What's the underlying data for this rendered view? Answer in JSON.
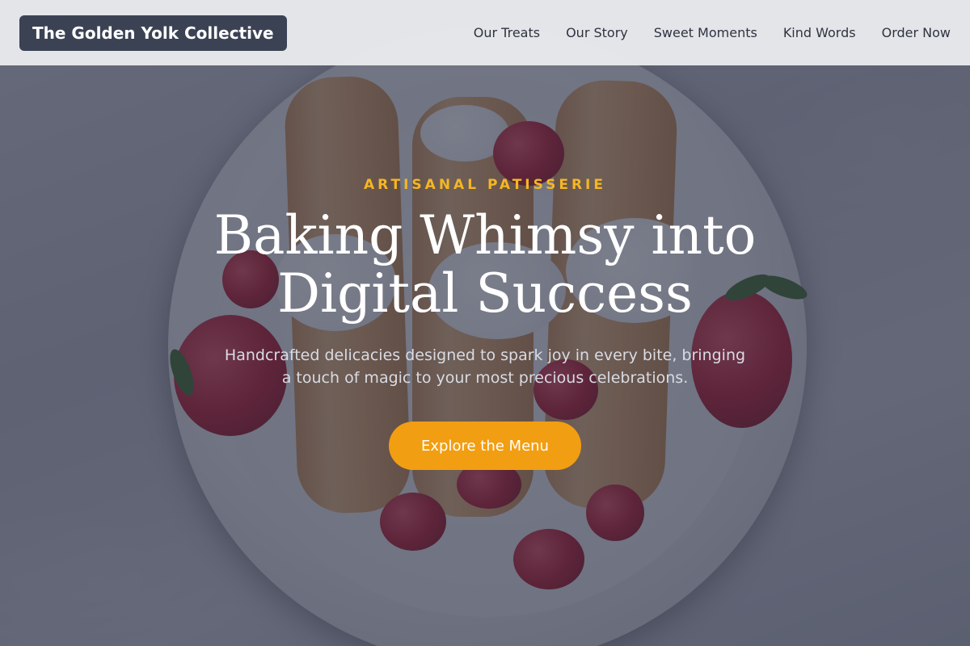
{
  "header": {
    "brand": "The Golden Yolk Collective",
    "nav": [
      {
        "label": "Our Treats"
      },
      {
        "label": "Our Story"
      },
      {
        "label": "Sweet Moments"
      },
      {
        "label": "Kind Words"
      },
      {
        "label": "Order Now"
      }
    ]
  },
  "hero": {
    "eyebrow": "ARTISANAL PATISSERIE",
    "headline": "Baking Whimsy into Digital Success",
    "subtext": "Handcrafted delicacies designed to spark joy in every bite, bringing a touch of magic to your most precious celebrations.",
    "cta_label": "Explore the Menu",
    "background_image": "crepes-with-berries-and-cream-photo"
  },
  "colors": {
    "accent": "#f29e12",
    "eyebrow": "#f5b623",
    "brand_bg": "#3b4254",
    "overlay": "#282d42"
  }
}
